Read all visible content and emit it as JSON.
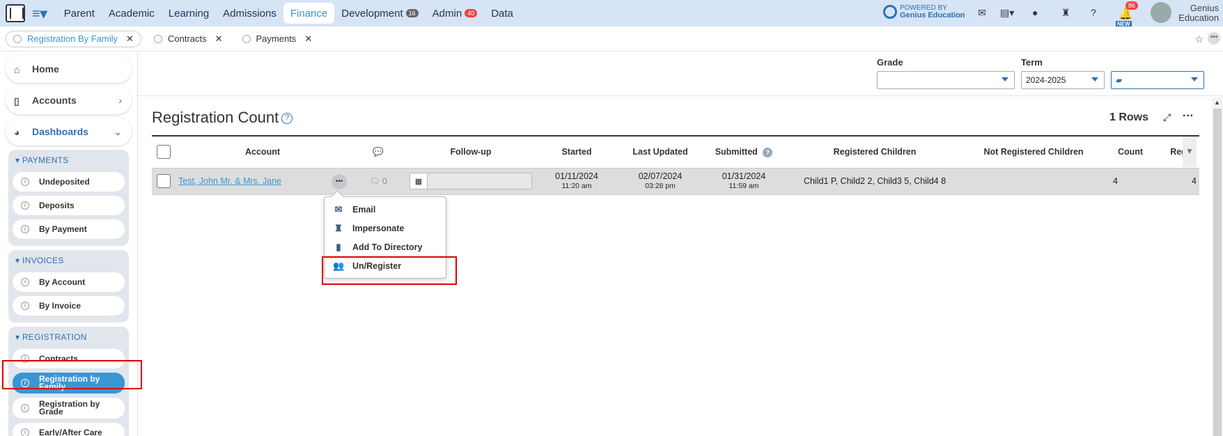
{
  "topnav": {
    "items": [
      {
        "label": "Parent",
        "badge": ""
      },
      {
        "label": "Academic",
        "badge": ""
      },
      {
        "label": "Learning",
        "badge": ""
      },
      {
        "label": "Admissions",
        "badge": ""
      },
      {
        "label": "Finance",
        "badge": ""
      },
      {
        "label": "Development",
        "badge": "16"
      },
      {
        "label": "Admin",
        "badge": "40"
      },
      {
        "label": "Data",
        "badge": ""
      }
    ],
    "powered_by": "POWERED BY",
    "brand": "Genius Education",
    "bell_count": "86",
    "new_label": "NEW",
    "user_line1": "Genius",
    "user_line2": "Education"
  },
  "tabs": [
    {
      "label": "Registration By Family"
    },
    {
      "label": "Contracts"
    },
    {
      "label": "Payments"
    }
  ],
  "sidebar": {
    "home": "Home",
    "accounts": "Accounts",
    "dashboards": "Dashboards",
    "payments_title": "PAYMENTS",
    "payments": [
      "Undeposited",
      "Deposits",
      "By Payment"
    ],
    "invoices_title": "INVOICES",
    "invoices": [
      "By Account",
      "By Invoice"
    ],
    "registration_title": "REGISTRATION",
    "registration": [
      "Contracts",
      "Registration by Family",
      "Registration by Grade",
      "Early/After Care"
    ]
  },
  "filters": {
    "grade_label": "Grade",
    "grade_value": "",
    "term_label": "Term",
    "term_value": "2024-2025"
  },
  "page": {
    "title": "Registration Count",
    "rows": "1 Rows"
  },
  "table": {
    "headers": [
      "Account",
      "",
      "Follow-up",
      "Started",
      "Last Updated",
      "Submitted",
      "Registered Children",
      "Not Registered Children",
      "Count",
      "Reg"
    ],
    "rows": [
      {
        "account": "Test, John Mr. & Mrs. Jane",
        "comments": "0",
        "started_date": "01/11/2024",
        "started_time": "11:20 am",
        "updated_date": "02/07/2024",
        "updated_time": "03:28 pm",
        "submitted_date": "01/31/2024",
        "submitted_time": "11:59 am",
        "registered": "Child1 P, Child2 2, Child3 5, Child4 8",
        "not_registered": "",
        "count": "4",
        "reg": "4"
      }
    ]
  },
  "popup": {
    "items": [
      "Email",
      "Impersonate",
      "Add To Directory",
      "Un/Register"
    ]
  }
}
